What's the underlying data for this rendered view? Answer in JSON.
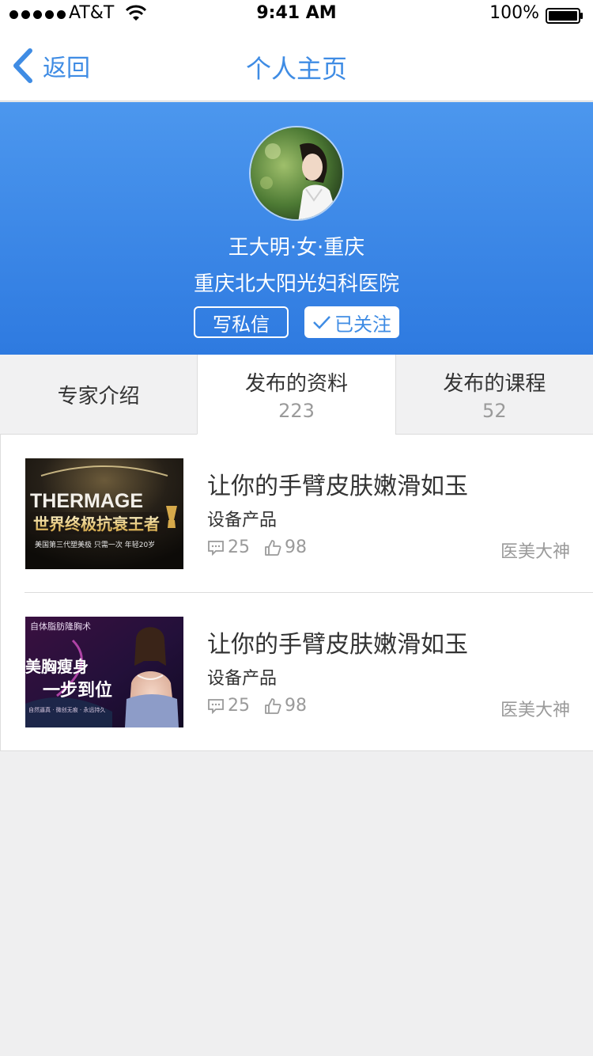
{
  "status_bar": {
    "carrier": "AT&T",
    "time": "9:41 AM",
    "battery": "100%"
  },
  "nav": {
    "back_label": "返回",
    "title": "个人主页"
  },
  "profile": {
    "name_line": "王大明·女·重庆",
    "hospital": "重庆北大阳光妇科医院",
    "message_button": "写私信",
    "follow_button": "已关注"
  },
  "tabs": [
    {
      "label": "专家介绍",
      "count": ""
    },
    {
      "label": "发布的资料",
      "count": "223"
    },
    {
      "label": "发布的课程",
      "count": "52"
    }
  ],
  "items": [
    {
      "title": "让你的手臂皮肤嫩滑如玉",
      "category": "设备产品",
      "comments": "25",
      "likes": "98",
      "author": "医美大神",
      "thumb_text": [
        "THERMAGE",
        "世界终极抗衰王者",
        "美国第三代塑美极 只需一次 年轻20岁"
      ]
    },
    {
      "title": "让你的手臂皮肤嫩滑如玉",
      "category": "设备产品",
      "comments": "25",
      "likes": "98",
      "author": "医美大神",
      "thumb_text": [
        "自体脂肪隆胸术",
        "美胸瘦身",
        "一步到位",
        "自然逼真 · 微创无痕 · 永远持久"
      ]
    }
  ],
  "colors": {
    "accent": "#3f8ce4",
    "header_gradient_top": "#4c97ee",
    "header_gradient_bottom": "#2e7ae0",
    "background": "#efeff0"
  }
}
